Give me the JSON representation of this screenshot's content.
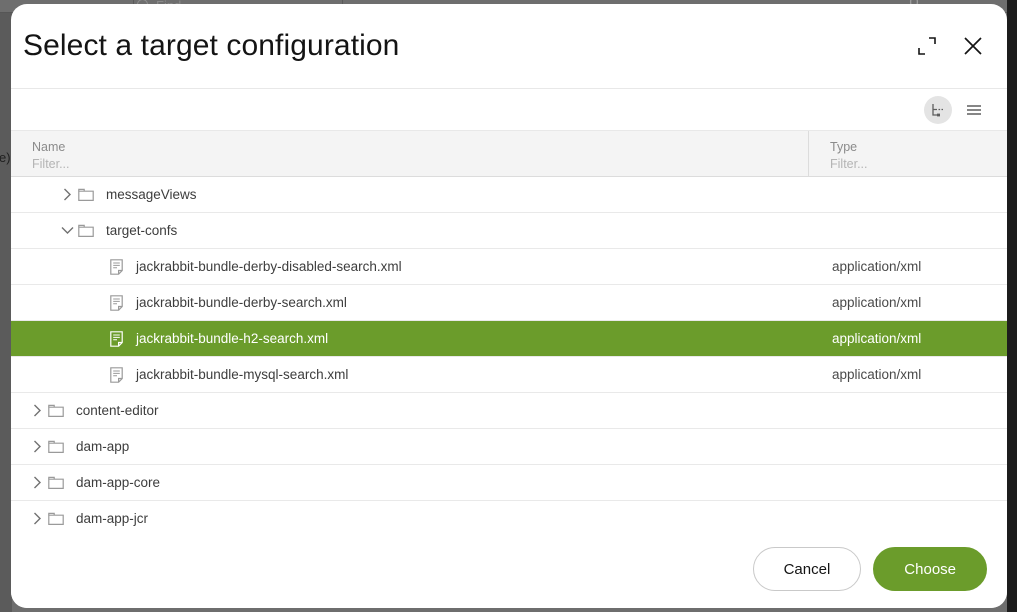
{
  "background": {
    "find_placeholder": "Find...",
    "overflow_menu": "...",
    "paren": "()",
    "side_text": "",
    "left_text": "e)"
  },
  "dialog": {
    "title": "Select a target configuration",
    "maximize_label": "Maximize",
    "close_label": "Close"
  },
  "toolbar": {
    "tree_view_label": "Tree view",
    "list_view_label": "List view"
  },
  "columns": [
    {
      "label": "Name",
      "filter_placeholder": "Filter..."
    },
    {
      "label": "Type",
      "filter_placeholder": "Filter..."
    }
  ],
  "rows": [
    {
      "label": "messageViews",
      "type": "",
      "kind": "folder",
      "indent": 1,
      "expanded": false,
      "selected": false
    },
    {
      "label": "target-confs",
      "type": "",
      "kind": "folder",
      "indent": 1,
      "expanded": true,
      "selected": false
    },
    {
      "label": "jackrabbit-bundle-derby-disabled-search.xml",
      "type": "application/xml",
      "kind": "file",
      "indent": 2,
      "expanded": null,
      "selected": false
    },
    {
      "label": "jackrabbit-bundle-derby-search.xml",
      "type": "application/xml",
      "kind": "file",
      "indent": 2,
      "expanded": null,
      "selected": false
    },
    {
      "label": "jackrabbit-bundle-h2-search.xml",
      "type": "application/xml",
      "kind": "file",
      "indent": 2,
      "expanded": null,
      "selected": true
    },
    {
      "label": "jackrabbit-bundle-mysql-search.xml",
      "type": "application/xml",
      "kind": "file",
      "indent": 2,
      "expanded": null,
      "selected": false
    },
    {
      "label": "content-editor",
      "type": "",
      "kind": "folder",
      "indent": 0,
      "expanded": false,
      "selected": false
    },
    {
      "label": "dam-app",
      "type": "",
      "kind": "folder",
      "indent": 0,
      "expanded": false,
      "selected": false
    },
    {
      "label": "dam-app-core",
      "type": "",
      "kind": "folder",
      "indent": 0,
      "expanded": false,
      "selected": false
    },
    {
      "label": "dam-app-jcr",
      "type": "",
      "kind": "folder",
      "indent": 0,
      "expanded": false,
      "selected": false
    }
  ],
  "footer": {
    "cancel_label": "Cancel",
    "choose_label": "Choose"
  },
  "colors": {
    "accent_green": "#6b9c2b",
    "header_bg": "#f4f4f4",
    "backdrop": "#6e6e6e"
  }
}
